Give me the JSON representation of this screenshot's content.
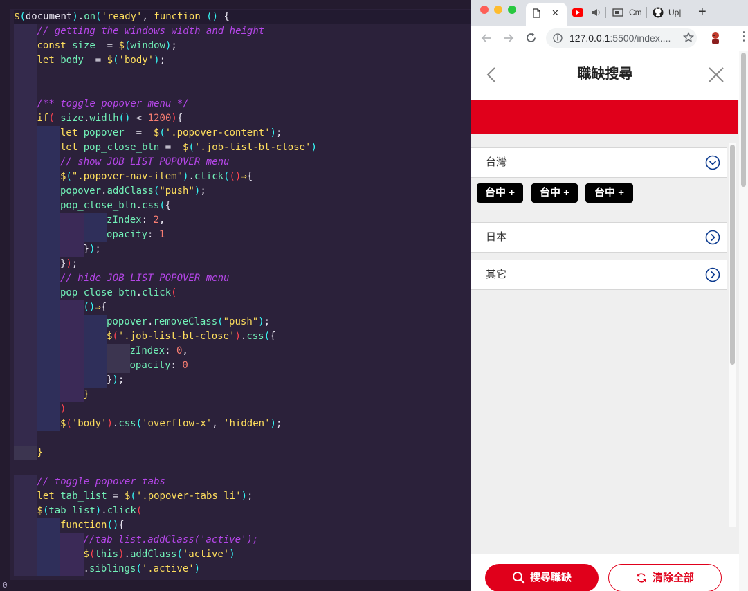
{
  "editor": {
    "status_text": "0",
    "code_lines": [
      "$(document).on('ready', function () {",
      "// getting the windows width and height",
      "const size  = $(window);",
      "let body  = $('body');",
      "",
      "",
      "/** toggle popover menu */",
      "if( size.width() < 1200){",
      "let popover  =  $('.popover-content');",
      "let pop_close_btn =  $('.job-list-bt-close')",
      "// show JOB LIST POPOVER menu",
      "$(\".popover-nav-item\").click(()⇒{",
      "popover.addClass(\"push\");",
      "pop_close_btn.css({",
      "zIndex: 2,",
      "opacity: 1",
      "});",
      "});",
      "// hide JOB LIST POPOVER menu",
      "pop_close_btn.click(",
      "()⇒{",
      "popover.removeClass(\"push\");",
      "$('.job-list-bt-close').css({",
      "zIndex: 0,",
      "opacity: 0",
      "});",
      "}",
      ")",
      "$('body').css('overflow-x', 'hidden');",
      "",
      "}",
      "",
      "// toggle popover tabs",
      "let tab_list = $('.popover-tabs li');",
      "$(tab_list).click(",
      "function(){",
      "//tab_list.addClass('active');",
      "$(this).addClass('active')",
      ".siblings('.active')"
    ]
  },
  "browser": {
    "tabs": [
      {
        "title": "",
        "icon": "document-icon",
        "active": true
      },
      {
        "title": "",
        "icon": "youtube-icon"
      },
      {
        "title": "",
        "icon": "speaker-icon"
      },
      {
        "title": "Cm",
        "icon": "cast-icon"
      },
      {
        "title": "Up|",
        "icon": "github-icon"
      }
    ],
    "close_glyph": "✕",
    "new_tab_glyph": "+",
    "url_host": "127.0.0.1",
    "url_rest": ":5500/index....",
    "colors": {
      "accent": "#e0001b",
      "accordion_icon": "#0b3a8f"
    }
  },
  "page": {
    "title": "職缺搜尋",
    "accordion": [
      {
        "label": "台灣",
        "expanded": true
      },
      {
        "label": "日本",
        "expanded": false
      },
      {
        "label": "其它",
        "expanded": false
      }
    ],
    "chips": [
      "台中 +",
      "台中 +",
      "台中 +"
    ],
    "search_button": "搜尋職缺",
    "clear_button": "清除全部"
  }
}
